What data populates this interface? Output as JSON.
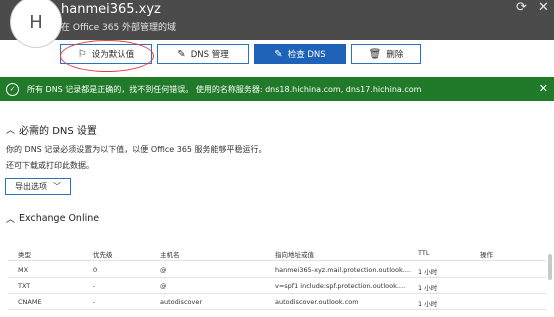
{
  "header": {
    "avatar_letter": "H",
    "domain": "hanmei365.xyz",
    "subtitle": "在 Office 365 外部管理的域",
    "icons": [
      "refresh-icon",
      "close-icon"
    ]
  },
  "toolbar": {
    "set_default": "设为默认值",
    "dns_manage": "DNS 管理",
    "check_dns": "检查 DNS",
    "delete": "删除"
  },
  "status": {
    "message": "所有 DNS 记录都是正确的，找不到任何错误。 使用的名称服务器: dns18.hichina.com, dns17.hichina.com",
    "color": "#207a2a"
  },
  "dns_section": {
    "title": "必需的 DNS 设置",
    "desc1": "你的 DNS 记录必须设置为以下值，以便 Office 365 服务能够平稳运行。",
    "desc2": "还可下载或打印此数据。",
    "export_label": "导出选项"
  },
  "exchange": {
    "title": "Exchange Online",
    "headers": [
      "类型",
      "优先级",
      "主机名",
      "指向地址或值",
      "TTL",
      "操作"
    ],
    "rows": [
      [
        "MX",
        "0",
        "@",
        "hanmei365-xyz.mail.protection.outlook....",
        "1 小时"
      ],
      [
        "TXT",
        "-",
        "@",
        "v=spf1 include:spf.protection.outlook....",
        "1 小时"
      ],
      [
        "CNAME",
        "-",
        "autodiscover",
        "autodiscover.outlook.com",
        "1 小时"
      ]
    ]
  }
}
